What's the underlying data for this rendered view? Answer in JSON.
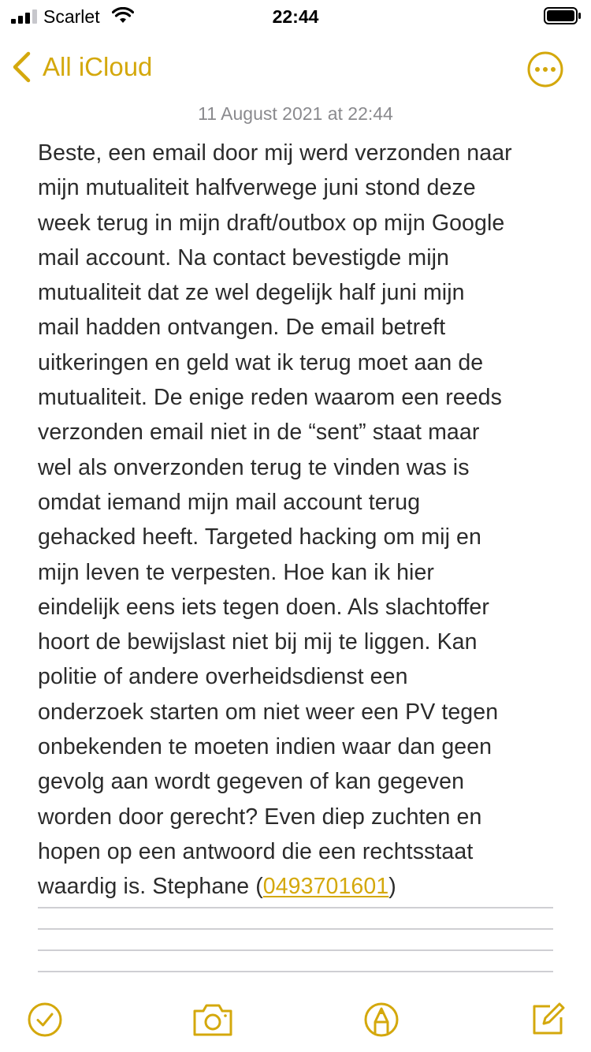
{
  "status_bar": {
    "carrier": "Scarlet",
    "time": "22:44"
  },
  "nav": {
    "back_label": "All iCloud",
    "more_icon": "ellipsis-circle-icon"
  },
  "note": {
    "date": "11 August 2021 at 22:44",
    "lines": [
      "Beste, een email door mij werd verzonden naar",
      "mijn mutualiteit halfverwege juni stond deze",
      "week terug in mijn draft/outbox op mijn Google",
      "mail account. Na contact bevestigde mijn",
      "mutualiteit dat ze wel degelijk half juni mijn",
      "mail hadden ontvangen. De email betreft",
      "uitkeringen en geld wat ik terug moet aan de",
      "mutualiteit. De enige reden waarom een reeds",
      "verzonden email niet in de “sent” staat maar",
      "wel als onverzonden terug te vinden was is",
      "omdat iemand mijn mail account terug",
      "gehacked heeft. Targeted hacking om mij en",
      "mijn leven te verpesten. Hoe kan ik hier",
      "eindelijk eens iets tegen doen. Als slachtoffer",
      "hoort de bewijslast niet bij mij te liggen. Kan",
      "politie of andere overheidsdienst een",
      "onderzoek starten om niet weer een PV tegen",
      "onbekenden te moeten indien waar dan geen",
      "gevolg aan wordt gegeven of kan gegeven",
      "worden door gerecht? Even diep zuchten en",
      "hopen op een antwoord die een rechtsstaat"
    ],
    "last_line_prefix": "waardig is. Stephane (",
    "phone": "0493701601",
    "last_line_suffix": ")"
  },
  "toolbar": {
    "items": [
      "checklist-icon",
      "camera-icon",
      "markup-pen-icon",
      "compose-icon"
    ]
  },
  "colors": {
    "accent": "#d4a80c",
    "date_gray": "#8a8a8e",
    "text": "#2b2b2b",
    "rule": "#cfcfd3"
  }
}
